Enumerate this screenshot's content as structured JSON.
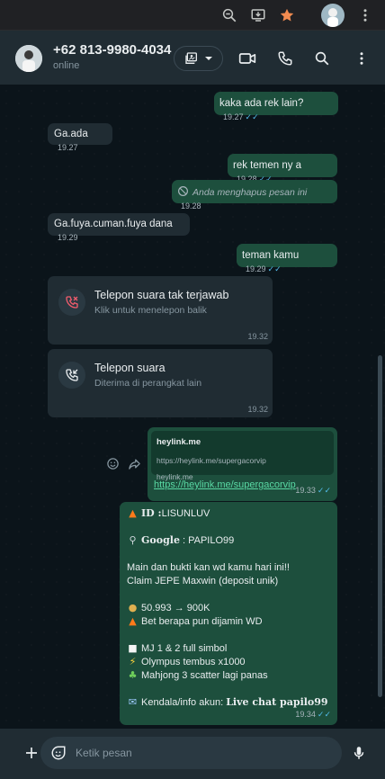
{
  "header": {
    "name": "+62 813-9980-4034",
    "status": "online"
  },
  "messages": [
    {
      "text": "kaka ada rek lain?",
      "time": "19.27"
    },
    {
      "text": "Ga.ada",
      "time": "19.27"
    },
    {
      "text": "rek temen ny a",
      "time": "19.28"
    },
    {
      "text": "Anda menghapus pesan ini",
      "time": "19.28"
    },
    {
      "text": "Ga.fuya.cuman.fuya dana",
      "time": "19.29"
    },
    {
      "text": "teman kamu",
      "time": "19.29"
    }
  ],
  "calls": [
    {
      "title": "Telepon suara tak terjawab",
      "subtitle": "Klik untuk menelepon balik",
      "time": "19.32"
    },
    {
      "title": "Telepon suara",
      "subtitle": "Diterima di perangkat lain",
      "time": "19.32"
    }
  ],
  "link_message": {
    "preview_title": "heylink.me",
    "preview_url": "https://heylink.me/supergacorvip",
    "preview_domain": "heylink.me",
    "url": "https://heylink.me/supergacorvip",
    "time": "19.33"
  },
  "promo": {
    "id_label": "ID :",
    "id_value": "LISUNLUV",
    "google_label": "Google",
    "google_value": " : PAPILO99",
    "line1": "Main dan bukti kan wd kamu hari ini!!",
    "line2": "Claim JEPE Maxwin (deposit unik)",
    "amount": "50.993 → 900K",
    "bet": "Bet berapa pun dijamin WD",
    "mj": "MJ 1 & 2 full simbol",
    "olympus": "Olympus tembus x1000",
    "mahjong": "Mahjong 3 scatter lagi panas",
    "contact_label": "Kendala/info akun: ",
    "contact_value": "Live chat papilo99",
    "time": "19.34"
  },
  "composer": {
    "placeholder": "Ketik pesan"
  },
  "colors": {
    "outgoing_bubble": "#1d4f3d",
    "incoming_bubble": "#202c33",
    "read_ticks": "#53bdeb",
    "link": "#59d9a4"
  }
}
